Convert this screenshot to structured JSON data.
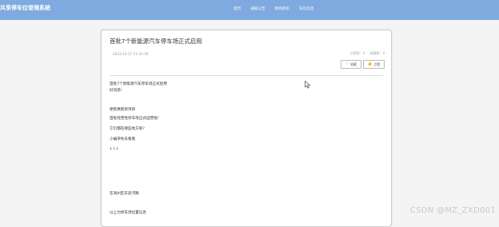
{
  "header": {
    "brand": "共享停车位管理系统",
    "nav": [
      "首页",
      "通知公告",
      "新闻资讯",
      "车位信息"
    ]
  },
  "article": {
    "title": "首批7个新能源汽车停车场正式启用",
    "time": "2023-12-17 11:41:39",
    "stats": [
      "点赞数：0",
      "收藏数：0"
    ],
    "collect_label": "收藏",
    "like_label": "点赞",
    "paragraphs": [
      "首批7个新能源汽车停车场正式启用",
      "好消息!",
      "",
      "",
      "便民惠民新项目",
      "首批经营性停车场正式运营啦！",
      "它们都在哪些地方呢?",
      "小编带你去看看",
      "↓↓↓",
      "",
      "",
      "",
      "",
      "",
      "在海州区东盐河路",
      "",
      "以上为停车场位置信息"
    ]
  },
  "watermark": "CSDN @MZ_ZXD001"
}
